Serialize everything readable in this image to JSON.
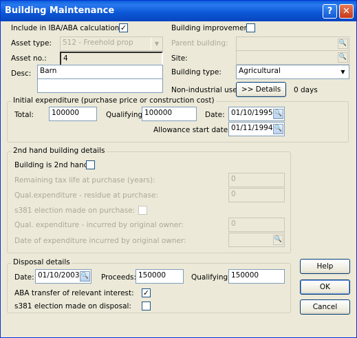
{
  "window": {
    "title": "Building Maintenance",
    "help_glyph": "?",
    "close_glyph": "✕"
  },
  "form": {
    "include_iba_label": "Include in IBA/ABA calculation:",
    "include_iba_checked": "✓",
    "asset_type_label": "Asset type:",
    "asset_type_value": "512 - Freehold prop",
    "asset_no_label": "Asset no.:",
    "asset_no_value": "4",
    "desc_label": "Desc:",
    "desc_line1": "Barn",
    "desc_line2": "",
    "building_improvement_label": "Building improvement:",
    "parent_building_label": "Parent building:",
    "site_label": "Site:",
    "building_type_label": "Building type:",
    "building_type_value": "Agricultural",
    "non_industrial_label": "Non-industrial use:",
    "details_button": ">> Details",
    "days_value": "0 days"
  },
  "initial": {
    "title": "Initial expenditure (purchase price or construction cost)",
    "total_label": "Total:",
    "total_value": "100000",
    "qualifying_label": "Qualifying:",
    "qualifying_value": "100000",
    "date_label": "Date:",
    "date_value": "01/10/1995",
    "allowance_label": "Allowance start date:",
    "allowance_value": "01/11/1994"
  },
  "secondhand": {
    "title": "2nd hand building details",
    "is_2nd_label": "Building is 2nd hand:",
    "remaining_label": "Remaining tax life at purchase (years):",
    "remaining_value": "0",
    "residue_label": "Qual.expenditure - residue at purchase:",
    "residue_value": "0",
    "s381_label": "s381 election made on purchase:",
    "orig_owner_label": "Qual. expenditure - incurred by original owner:",
    "orig_owner_value": "0",
    "date_orig_label": "Date of expenditure incurred by original owner:"
  },
  "disposal": {
    "title": "Disposal details",
    "date_label": "Date:",
    "date_value": "01/10/2003",
    "proceeds_label": "Proceeds:",
    "proceeds_value": "150000",
    "qualifying_label": "Qualifying:",
    "qualifying_value": "150000",
    "aba_label": "ABA transfer of relevant interest:",
    "aba_checked": "✓",
    "s381_label": "s381 election made on disposal:"
  },
  "buttons": {
    "help": "Help",
    "ok": "OK",
    "cancel": "Cancel"
  },
  "icons": {
    "calendar": "calendar-icon",
    "search": "search-icon",
    "dropdown": "chevron-down-icon"
  }
}
